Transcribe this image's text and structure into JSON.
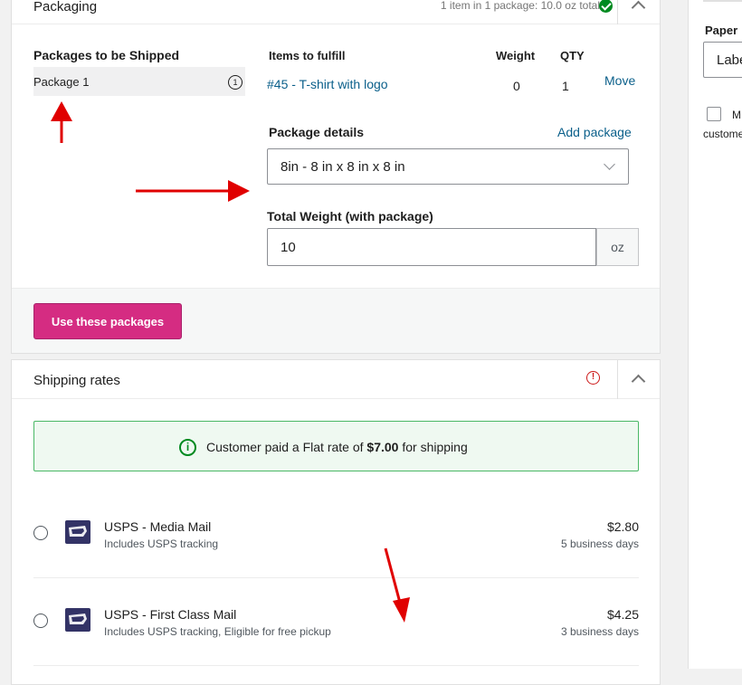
{
  "packaging": {
    "title": "Packaging",
    "summary": "1 item in 1 package: 10.0 oz total",
    "packages_heading": "Packages to be Shipped",
    "packages": [
      {
        "label": "Package 1",
        "count": "1"
      }
    ],
    "items_heading": "Items to fulfill",
    "weight_heading": "Weight",
    "qty_heading": "QTY",
    "items": [
      {
        "name": "#45 - T-shirt with logo",
        "weight": "0",
        "qty": "1",
        "action": "Move"
      }
    ],
    "details_heading": "Package details",
    "add_package_label": "Add package",
    "package_select_value": "8in - 8 in x 8 in x 8 in",
    "total_weight_label": "Total Weight (with package)",
    "total_weight_value": "10",
    "weight_unit": "oz",
    "use_packages_label": "Use these packages"
  },
  "rates": {
    "title": "Shipping rates",
    "notice_prefix": "Customer paid a Flat rate of ",
    "notice_amount": "$7.00",
    "notice_suffix": " for shipping",
    "options": [
      {
        "name": "USPS - Media Mail",
        "details": "Includes USPS tracking",
        "price": "$2.80",
        "delivery": "5 business days"
      },
      {
        "name": "USPS - First Class Mail",
        "details": "Includes USPS tracking, Eligible for free pickup",
        "price": "$4.25",
        "delivery": "3 business days"
      }
    ]
  },
  "sidebar": {
    "paper_label": "Paper",
    "paper_value": "Labe",
    "checkbox_label": "M",
    "checkbox_sub": "custome"
  },
  "colors": {
    "primary_button": "#d52c82",
    "link": "#0a5f8a",
    "success": "#008a20",
    "error": "#cc1818",
    "notice_bg": "#eff9f1",
    "annotation_arrow": "#e00000"
  },
  "icons": [
    "check-circle-icon",
    "chevron-up-icon",
    "chevron-down-icon",
    "alert-circle-icon",
    "info-circle-icon",
    "usps-logo-icon"
  ]
}
